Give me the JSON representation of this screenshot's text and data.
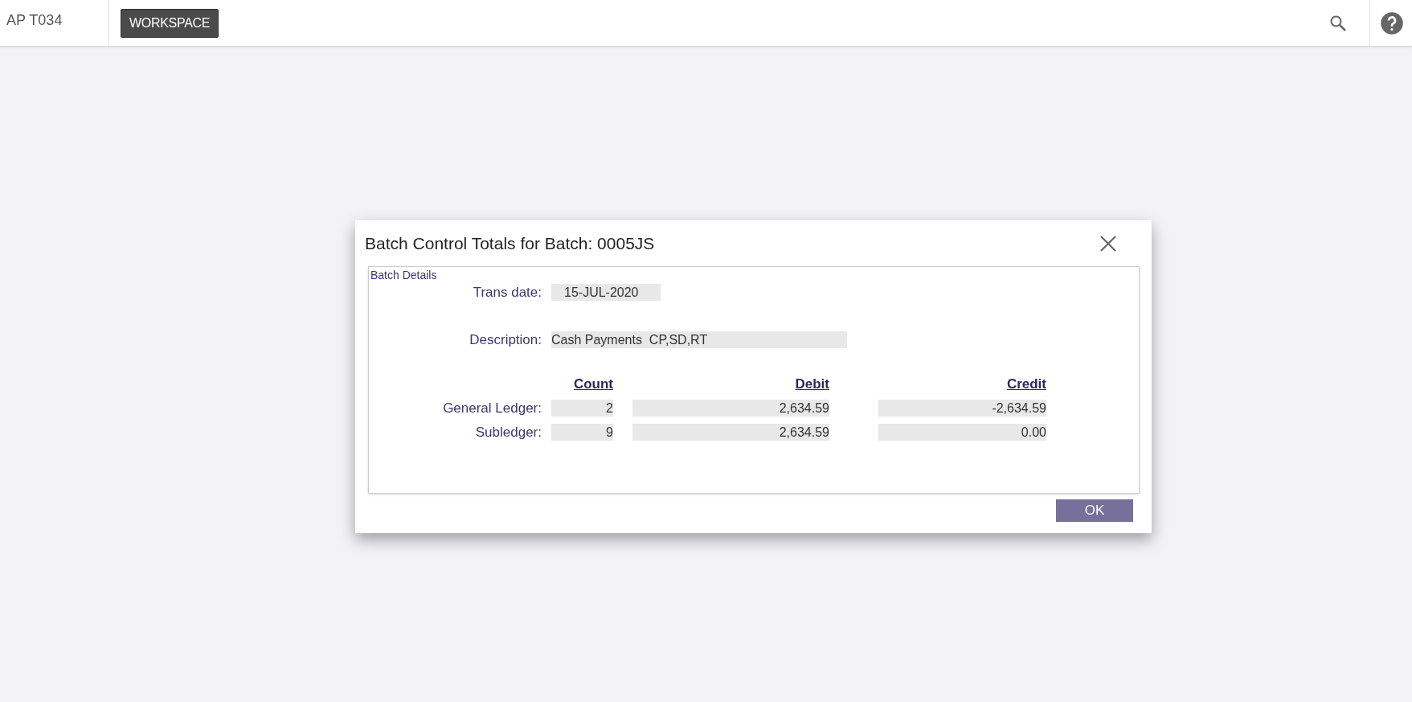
{
  "top_bar": {
    "app_title": "AP T034",
    "workspace_button": "WORKSPACE"
  },
  "dialog": {
    "title": "Batch Control Totals for Batch: 0005JS",
    "group_label": "Batch Details",
    "fields": [
      {
        "label": "Trans date:",
        "value": "15-JUL-2020",
        "kind": "date"
      },
      {
        "label": "Description:",
        "value": "Cash Payments  CP,SD,RT",
        "kind": "text"
      }
    ],
    "totals": {
      "columns": [
        "Count",
        "Debit",
        "Credit"
      ],
      "rows": [
        {
          "label": "General Ledger:",
          "count": "2",
          "debit": "2,634.59",
          "credit": "-2,634.59"
        },
        {
          "label": "Subledger:",
          "count": "9",
          "debit": "2,634.59",
          "credit": "0.00"
        }
      ]
    },
    "ok_button": "OK"
  }
}
